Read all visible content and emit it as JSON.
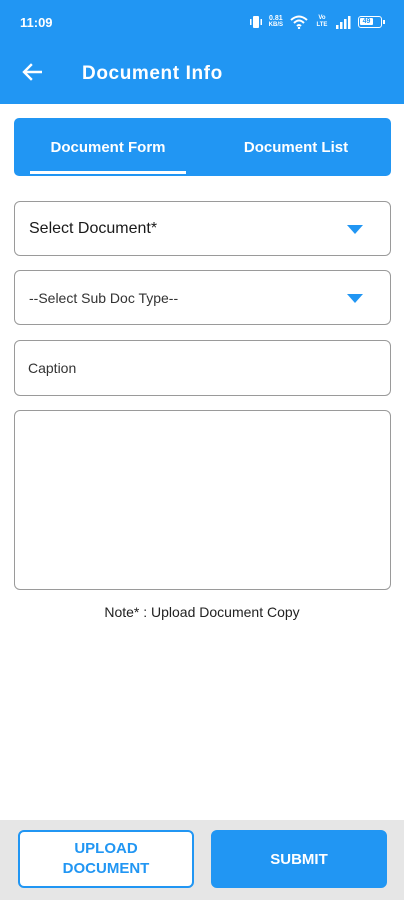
{
  "status_bar": {
    "time": "11:09",
    "speed_value": "0.81",
    "speed_unit": "KB/S",
    "volte_label": "Vo LTE",
    "battery_level": "49",
    "icons": [
      "vibrate-icon",
      "wifi-icon",
      "volte-icon",
      "signal-icon",
      "battery-icon"
    ]
  },
  "toolbar": {
    "title": "Document Info",
    "back_icon": "arrow-back-icon"
  },
  "tabs": [
    {
      "label": "Document Form",
      "selected": true
    },
    {
      "label": "Document List",
      "selected": false
    }
  ],
  "form": {
    "select_document": {
      "value": "Select Document*",
      "icon": "dropdown-arrow-icon"
    },
    "select_sub_doc_type": {
      "value": "--Select Sub Doc Type--",
      "icon": "dropdown-arrow-icon"
    },
    "caption": {
      "value": "",
      "placeholder": "Caption"
    },
    "note": "Note* : Upload Document Copy"
  },
  "actions": {
    "upload_label": "UPLOAD DOCUMENT",
    "submit_label": "SUBMIT"
  },
  "colors": {
    "primary": "#2196f3",
    "bottom_bar": "#e6e6e6",
    "field_border": "#9a9a9a"
  }
}
